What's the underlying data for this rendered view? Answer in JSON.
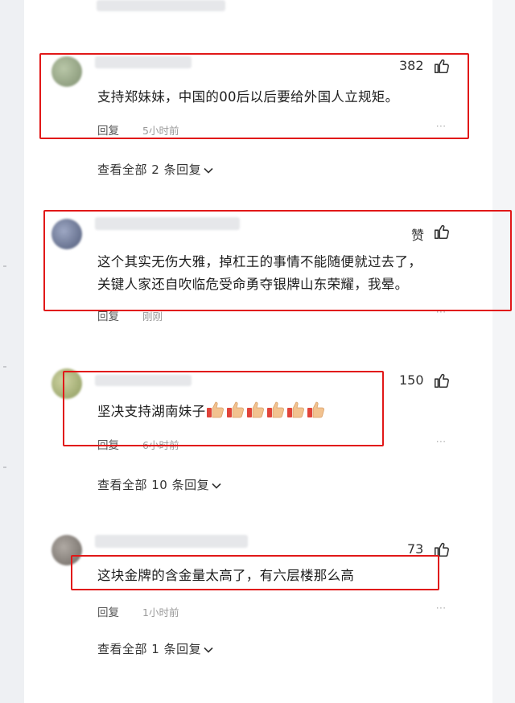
{
  "comments": [
    {
      "likes": "382",
      "text": "支持郑妹妹，中国的00后以后要给外国人立规矩。",
      "reply_label": "回复",
      "time": "5小时前",
      "view_all": "查看全部 2 条回复"
    },
    {
      "likes": "赞",
      "text_line1": "这个其实无伤大雅，掉杠王的事情不能随便就过去了，",
      "text_line2": "关键人家还自吹临危受命勇夺银牌山东荣耀，我晕。",
      "reply_label": "回复",
      "time": "刚刚"
    },
    {
      "likes": "150",
      "text": "坚决支持湖南妹子",
      "reply_label": "回复",
      "time": "6小时前",
      "view_all": "查看全部 10 条回复"
    },
    {
      "likes": "73",
      "text": "这块金牌的含金量太高了，有六层楼那么高",
      "reply_label": "回复",
      "time": "1小时前",
      "view_all": "查看全部 1 条回复"
    }
  ],
  "icons": {
    "like": "thumbs-up-outline-icon",
    "more": "more-dots-icon",
    "chevron": "chevron-down-icon",
    "emoji": "thumbs-up-emoji"
  },
  "colors": {
    "highlight_box": "#e11818",
    "text": "#1d1d1d",
    "muted": "#9a9a9a"
  }
}
